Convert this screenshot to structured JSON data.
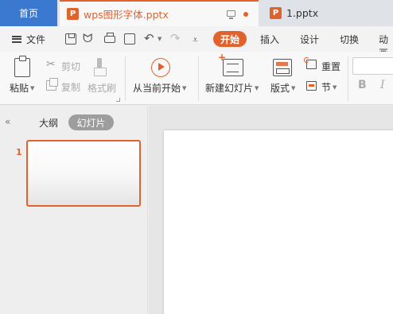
{
  "tabs": {
    "home": "首页",
    "doc1": {
      "icon": "P",
      "title": "wps图形字体.pptx"
    },
    "doc2": {
      "icon": "P",
      "title": "1.pptx"
    }
  },
  "quickbar": {
    "file_menu": "文件",
    "icons": [
      "save-icon",
      "custom-tool-icon",
      "print-icon",
      "print-preview-icon",
      "undo-icon",
      "redo-icon",
      "customize-dropdown-icon"
    ]
  },
  "ribbon_tabs": {
    "start": "开始",
    "insert": "插入",
    "design": "设计",
    "transitions": "切换",
    "animation": "动画"
  },
  "ribbon": {
    "paste": "粘贴",
    "cut": "剪切",
    "copy": "复制",
    "format_painter": "格式刷",
    "play_from_current": "从当前开始",
    "new_slide": "新建幻灯片",
    "layout": "版式",
    "reset": "重置",
    "section": "节",
    "bold": "B",
    "italic": "I"
  },
  "left_panel": {
    "outline_tab": "大纲",
    "slides_tab": "幻灯片",
    "slides": [
      {
        "number": "1"
      }
    ]
  },
  "colors": {
    "accent": "#e0632e",
    "home_tab": "#3b79d1"
  }
}
